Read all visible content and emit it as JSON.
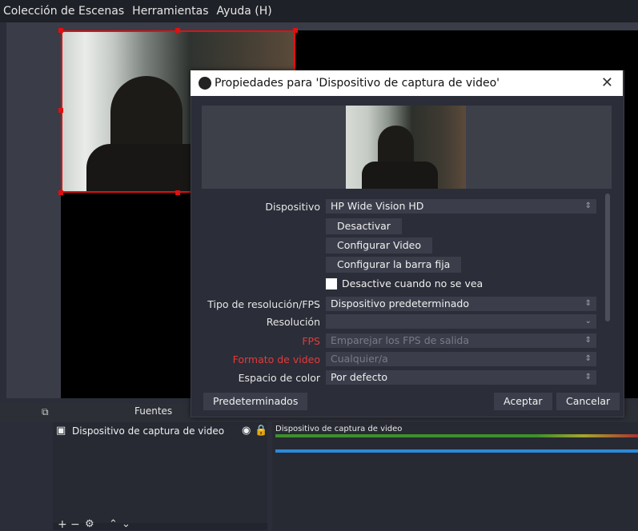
{
  "menu": {
    "items": [
      "Colección de Escenas",
      "Herramientas",
      "Ayuda (H)"
    ]
  },
  "docks": {
    "fuentes_title": "Fuentes",
    "source_item": "Dispositivo de captura de video",
    "mixer_source": "Dispositivo de captura de video"
  },
  "dialog": {
    "title": "Propiedades para 'Dispositivo de captura de video'",
    "fields": {
      "dispositivo_label": "Dispositivo",
      "dispositivo_value": "HP Wide Vision HD",
      "desactivar": "Desactivar",
      "configurar_video": "Configurar Video",
      "configurar_barra": "Configurar la barra fija",
      "desactive_label": "Desactive cuando no se vea",
      "tipo_res_label": "Tipo de resolución/FPS",
      "tipo_res_value": "Dispositivo predeterminado",
      "resolucion_label": "Resolución",
      "resolucion_value": "",
      "fps_label": "FPS",
      "fps_value": "Emparejar los FPS de salida",
      "formato_label": "Formato de video",
      "formato_value": "Cualquier/a",
      "espacio_label": "Espacio de color",
      "espacio_value": "Por defecto"
    },
    "buttons": {
      "predeterminados": "Predeterminados",
      "aceptar": "Aceptar",
      "cancelar": "Cancelar"
    }
  },
  "colors": {
    "accent_red": "#e01010",
    "dialog_bg": "#2b2e38",
    "meter_blue": "#2b8ad8"
  },
  "icons": [
    "obs-logo-icon",
    "close-icon",
    "camera-icon",
    "eye-icon",
    "lock-icon",
    "add-icon",
    "remove-icon",
    "gear-icon",
    "up-icon",
    "down-icon"
  ]
}
